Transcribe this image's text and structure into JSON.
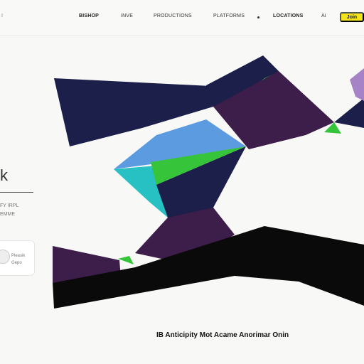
{
  "nav": {
    "brand": "I",
    "items": [
      "BISHOP",
      "INVE",
      "PRODUCTIONS",
      "PLATFORMS",
      "LOCATIONS",
      "Ai"
    ],
    "cta": "Join"
  },
  "hero": {
    "left_heading": "k",
    "left_lines": [
      "FY IRPL",
      "EMME"
    ],
    "card_lines": [
      "Pleasik",
      "Gepo"
    ],
    "caption": "IB Anticipity Mot Acame Anorimar Onin"
  },
  "colors": {
    "navy": "#1b1f49",
    "purple": "#3d1d4a",
    "green": "#36c43a",
    "teal": "#27c1c3",
    "blue": "#5c9be0",
    "lavender": "#a683c7",
    "black": "#0a0a0a",
    "cta": "#f2e31b"
  }
}
